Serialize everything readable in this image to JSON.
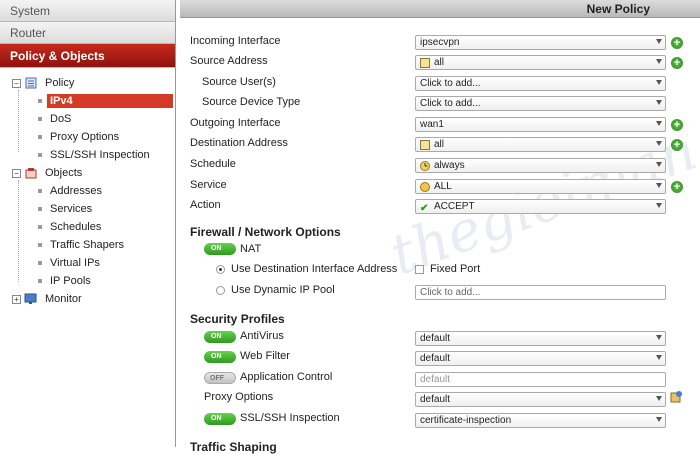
{
  "sidebar": {
    "sections": {
      "system": "System",
      "router": "Router",
      "policy_objects": "Policy & Objects",
      "monitor": "Monitor"
    },
    "policy": {
      "label": "Policy",
      "items": [
        "IPv4",
        "DoS",
        "Proxy Options",
        "SSL/SSH Inspection"
      ]
    },
    "objects": {
      "label": "Objects",
      "items": [
        "Addresses",
        "Services",
        "Schedules",
        "Traffic Shapers",
        "Virtual IPs",
        "IP Pools"
      ]
    }
  },
  "header": {
    "title": "New Policy"
  },
  "form": {
    "incoming_interface": {
      "label": "Incoming Interface",
      "value": "ipsecvpn"
    },
    "source_address": {
      "label": "Source Address",
      "value": "all"
    },
    "source_users": {
      "label": "Source User(s)",
      "value": "Click to add..."
    },
    "source_device_type": {
      "label": "Source Device Type",
      "value": "Click to add..."
    },
    "outgoing_interface": {
      "label": "Outgoing Interface",
      "value": "wan1"
    },
    "destination_address": {
      "label": "Destination Address",
      "value": "all"
    },
    "schedule": {
      "label": "Schedule",
      "value": "always"
    },
    "service": {
      "label": "Service",
      "value": "ALL"
    },
    "action": {
      "label": "Action",
      "value": "ACCEPT"
    }
  },
  "firewall": {
    "title": "Firewall / Network Options",
    "nat": {
      "toggle": "ON",
      "label": "NAT"
    },
    "use_dest_iface": "Use Destination Interface Address",
    "fixed_port": "Fixed Port",
    "use_dynamic_pool": "Use Dynamic IP Pool",
    "pool_placeholder": "Click to add..."
  },
  "security": {
    "title": "Security Profiles",
    "antivirus": {
      "toggle": "ON",
      "label": "AntiVirus",
      "value": "default"
    },
    "web_filter": {
      "toggle": "ON",
      "label": "Web Filter",
      "value": "default"
    },
    "app_control": {
      "toggle": "OFF",
      "label": "Application Control",
      "value": "default"
    },
    "proxy_options": {
      "label": "Proxy Options",
      "value": "default"
    },
    "ssl_ssh": {
      "toggle": "ON",
      "label": "SSL/SSH Inspection",
      "value": "certificate-inspection"
    }
  },
  "footer_partial": "Traffic Shaping",
  "colors": {
    "accent": "#b51f15",
    "toggle_on": "#3fae2a",
    "plus": "#3f9f2a"
  }
}
